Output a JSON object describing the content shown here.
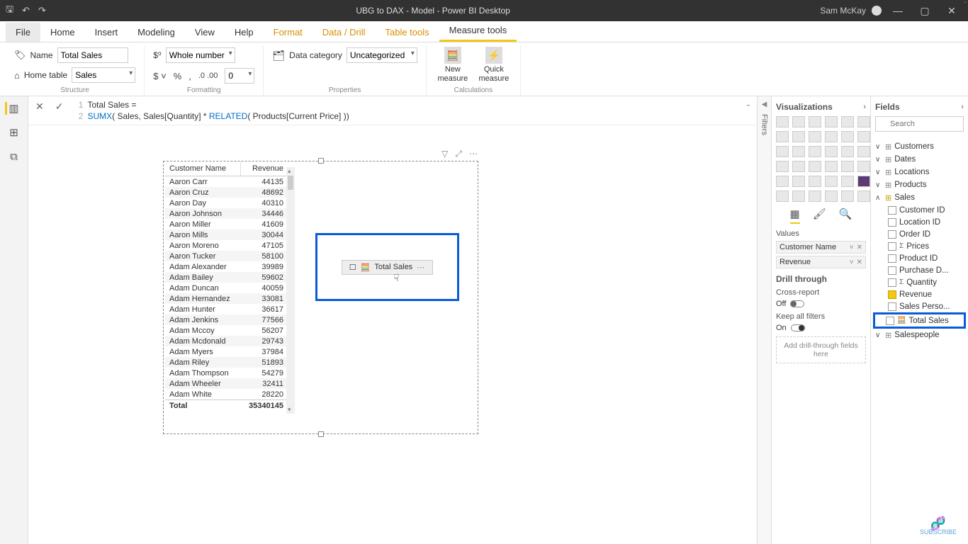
{
  "titlebar": {
    "title": "UBG to DAX - Model - Power BI Desktop",
    "user": "Sam McKay"
  },
  "tabs": [
    "File",
    "Home",
    "Insert",
    "Modeling",
    "View",
    "Help",
    "Format",
    "Data / Drill",
    "Table tools",
    "Measure tools"
  ],
  "ribbon": {
    "structure": {
      "name_label": "Name",
      "name_value": "Total Sales",
      "home_label": "Home table",
      "home_value": "Sales",
      "group": "Structure"
    },
    "formatting": {
      "format_value": "Whole number",
      "decimals": "0",
      "group": "Formatting"
    },
    "properties": {
      "cat_label": "Data category",
      "cat_value": "Uncategorized",
      "group": "Properties"
    },
    "calculations": {
      "new_measure": "New\nmeasure",
      "quick_measure": "Quick\nmeasure",
      "group": "Calculations"
    }
  },
  "formula": {
    "line1_num": "1",
    "line1": "Total Sales =",
    "line2_num": "2",
    "line2a": "SUMX",
    "line2b": "( Sales, Sales[Quantity] * ",
    "line2c": "RELATED",
    "line2d": "( Products[Current Price] ))"
  },
  "vis_table": {
    "columns": [
      "Customer Name",
      "Revenue"
    ],
    "rows": [
      [
        "Aaron Carr",
        "44135"
      ],
      [
        "Aaron Cruz",
        "48692"
      ],
      [
        "Aaron Day",
        "40310"
      ],
      [
        "Aaron Johnson",
        "34446"
      ],
      [
        "Aaron Miller",
        "41609"
      ],
      [
        "Aaron Mills",
        "30044"
      ],
      [
        "Aaron Moreno",
        "47105"
      ],
      [
        "Aaron Tucker",
        "58100"
      ],
      [
        "Adam Alexander",
        "39989"
      ],
      [
        "Adam Bailey",
        "59602"
      ],
      [
        "Adam Duncan",
        "40059"
      ],
      [
        "Adam Hernandez",
        "33081"
      ],
      [
        "Adam Hunter",
        "36617"
      ],
      [
        "Adam Jenkins",
        "77566"
      ],
      [
        "Adam Mccoy",
        "56207"
      ],
      [
        "Adam Mcdonald",
        "29743"
      ],
      [
        "Adam Myers",
        "37984"
      ],
      [
        "Adam Riley",
        "51893"
      ],
      [
        "Adam Thompson",
        "54279"
      ],
      [
        "Adam Wheeler",
        "32411"
      ],
      [
        "Adam White",
        "28220"
      ]
    ],
    "total_label": "Total",
    "total_value": "35340145"
  },
  "drag_chip": "Total Sales",
  "vis_pane": {
    "title": "Visualizations",
    "values_label": "Values",
    "values_fields": [
      "Customer Name",
      "Revenue"
    ],
    "drill_title": "Drill through",
    "cross": "Cross-report",
    "cross_state": "Off",
    "keep": "Keep all filters",
    "keep_state": "On",
    "drill_placeholder": "Add drill-through fields here"
  },
  "filters_label": "Filters",
  "fields_pane": {
    "title": "Fields",
    "search_placeholder": "Search",
    "tables": [
      "Customers",
      "Dates",
      "Locations",
      "Products"
    ],
    "sales": "Sales",
    "sales_fields": [
      {
        "name": "Customer ID",
        "checked": false
      },
      {
        "name": "Location ID",
        "checked": false
      },
      {
        "name": "Order ID",
        "checked": false
      },
      {
        "name": "Prices",
        "checked": false,
        "sigma": true
      },
      {
        "name": "Product ID",
        "checked": false
      },
      {
        "name": "Purchase D...",
        "checked": false
      },
      {
        "name": "Quantity",
        "checked": false,
        "sigma": true
      },
      {
        "name": "Revenue",
        "checked": true
      },
      {
        "name": "Sales Perso...",
        "checked": false
      }
    ],
    "total_sales": "Total Sales",
    "salespeople": "Salespeople"
  },
  "subscribe": "SUBSCRIBE"
}
